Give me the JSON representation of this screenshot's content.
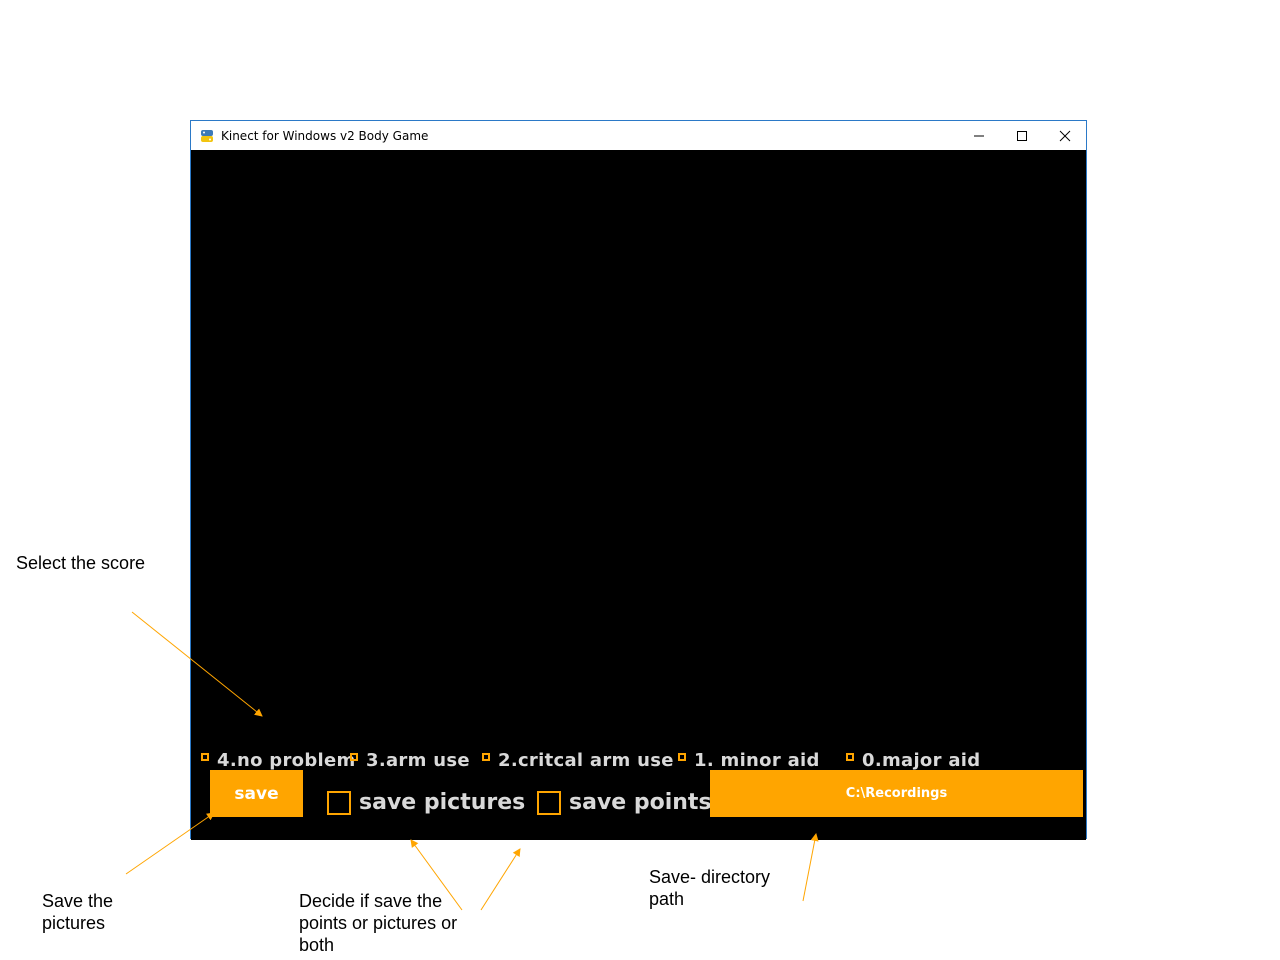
{
  "window": {
    "title": "Kinect for Windows v2 Body Game",
    "icon": "python-icon",
    "controls": [
      "minimize-icon",
      "maximize-icon",
      "close-icon"
    ]
  },
  "scores": [
    {
      "label": "4.no problem"
    },
    {
      "label": "3.arm use"
    },
    {
      "label": "2.critcal arm use"
    },
    {
      "label": "1. minor aid"
    },
    {
      "label": "0.major aid"
    }
  ],
  "toolbar": {
    "save_label": "save",
    "save_pictures_label": "save pictures",
    "save_points_label": "save points",
    "path": "C:\\Recordings"
  },
  "annotations": {
    "select_score": "Select the score",
    "save_pictures": "Save the pictures",
    "decide": "Decide if save the points or pictures or both",
    "directory": "Save- directory path"
  },
  "colors": {
    "accent": "#ffa500",
    "canvas": "#000000",
    "label": "#d9d9d9"
  }
}
